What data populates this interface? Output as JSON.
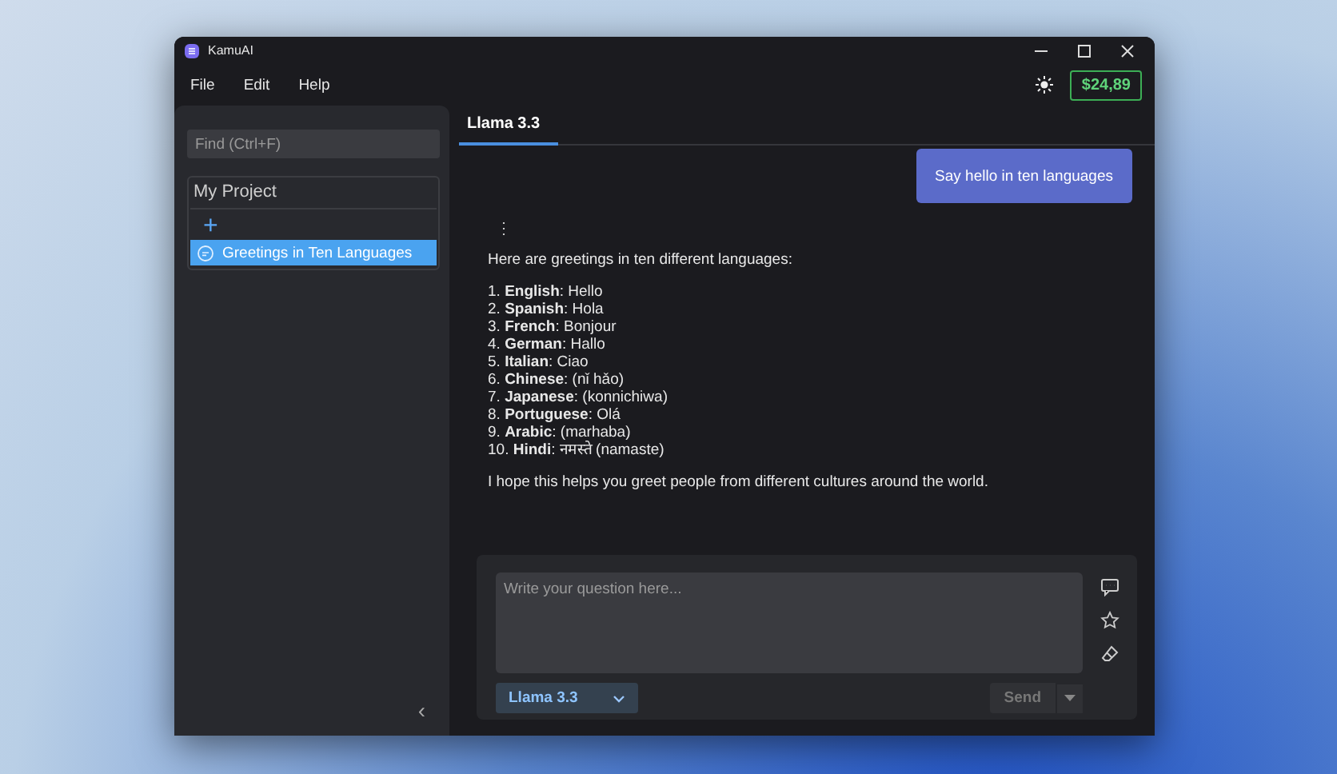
{
  "window": {
    "title": "KamuAI"
  },
  "menu": [
    "File",
    "Edit",
    "Help"
  ],
  "balance": "$24,89",
  "sidebar": {
    "search": {
      "placeholder": "Find (Ctrl+F)"
    },
    "project": {
      "title": "My Project",
      "add": "+",
      "chats": [
        {
          "title": "Greetings in Ten Languages",
          "selected": true
        }
      ]
    },
    "collapse": "‹"
  },
  "tabs": [
    {
      "label": "Llama 3.3",
      "selected": true
    }
  ],
  "messages": [
    {
      "kind": "user",
      "text": "Say hello in ten languages"
    },
    {
      "kind": "assistant",
      "menu": "⋮",
      "intro": "Here are greetings in ten different languages:",
      "items": [
        "1. **English**: Hello",
        "2. **Spanish**: Hola",
        "3. **French**: Bonjour",
        "4. **German**: Hallo",
        "5. **Italian**: Ciao",
        "6. **Chinese**: (nǐ hǎo)",
        "7. **Japanese**: (konnichiwa)",
        "8. **Portuguese**: Olá",
        "9. **Arabic**: (marhaba)",
        "10. **Hindi**: नमस्ते (namaste)"
      ],
      "outro": "I hope this helps you greet people from different cultures around the world."
    }
  ],
  "composer": {
    "placeholder": "Write your question here...",
    "model": "Llama 3.3",
    "send": {
      "label": "Send",
      "disabled": true
    }
  }
}
